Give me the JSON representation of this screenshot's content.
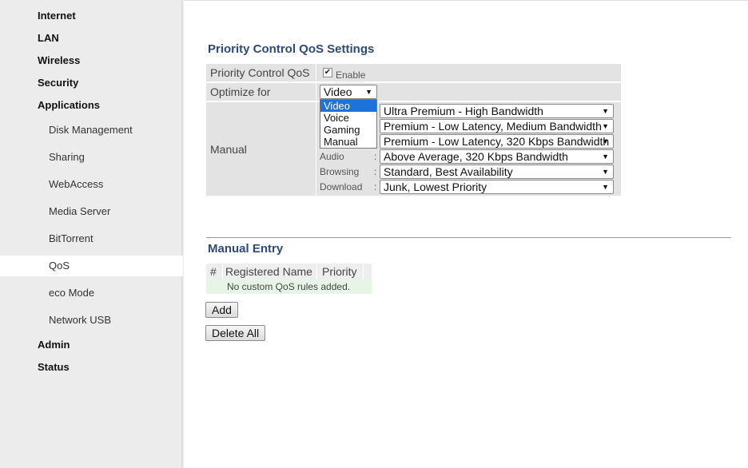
{
  "sidebar": {
    "items": [
      {
        "label": "Internet"
      },
      {
        "label": "LAN"
      },
      {
        "label": "Wireless"
      },
      {
        "label": "Security"
      },
      {
        "label": "Applications"
      },
      {
        "label": "Disk Management"
      },
      {
        "label": "Sharing"
      },
      {
        "label": "WebAccess"
      },
      {
        "label": "Media Server"
      },
      {
        "label": "BitTorrent"
      },
      {
        "label": "QoS",
        "selected": true
      },
      {
        "label": "eco Mode"
      },
      {
        "label": "Network USB"
      },
      {
        "label": "Admin"
      },
      {
        "label": "Status"
      }
    ]
  },
  "qos_settings": {
    "title": "Priority Control QoS Settings",
    "priority_control_label": "Priority Control QoS",
    "enable_label": "Enable",
    "enable_checked": true,
    "optimize_label": "Optimize for",
    "optimize_value": "Video",
    "optimize_options": [
      "Video",
      "Voice",
      "Gaming",
      "Manual"
    ],
    "manual_label": "Manual",
    "manual_rows": [
      {
        "label": "",
        "value": "Ultra Premium - High Bandwidth"
      },
      {
        "label": "",
        "value": "Premium - Low Latency, Medium Bandwidth"
      },
      {
        "label": "",
        "value": "Premium - Low Latency, 320 Kbps Bandwidth"
      },
      {
        "label": "Audio",
        "value": "Above Average, 320 Kbps Bandwidth"
      },
      {
        "label": "Browsing",
        "value": "Standard, Best Availability"
      },
      {
        "label": "Download",
        "value": "Junk, Lowest Priority"
      }
    ]
  },
  "manual_entry": {
    "title": "Manual Entry",
    "columns": [
      "#",
      "Registered Name",
      "Priority"
    ],
    "empty_text": "No custom QoS rules added.",
    "add_label": "Add",
    "delete_all_label": "Delete All"
  },
  "colors": {
    "title": "#2f4a7a",
    "sidebar_bg": "#ececec",
    "row_bg": "#e3e3e3",
    "dropdown_highlight": "#1e72d9",
    "empty_row_bg": "#e7f5e7"
  }
}
